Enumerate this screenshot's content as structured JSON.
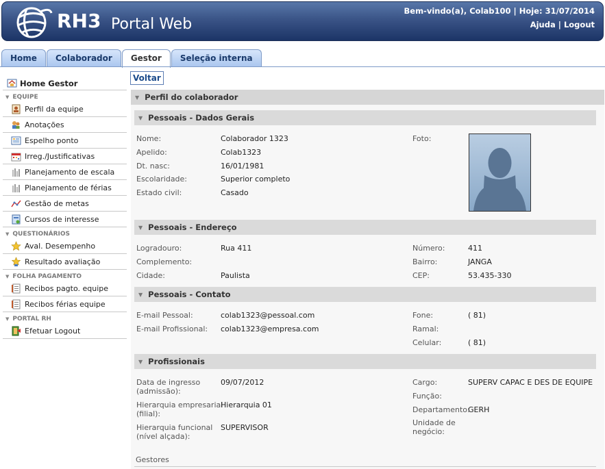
{
  "header": {
    "logo_text": "RH3",
    "logo_sub": "Portal Web",
    "welcome": "Bem-vindo(a), Colab100 | Hoje: 31/07/2014",
    "help": "Ajuda",
    "separator": "|",
    "logout": "Logout"
  },
  "tabs": [
    "Home",
    "Colaborador",
    "Gestor",
    "Seleção interna"
  ],
  "active_tab": "Gestor",
  "sidebar": {
    "home": "Home Gestor",
    "groups": [
      {
        "title": "EQUIPE",
        "items": [
          "Perfil da equipe",
          "Anotações",
          "Espelho ponto",
          "Irreg./Justificativas",
          "Planejamento de escala",
          "Planejamento de férias",
          "Gestão de metas",
          "Cursos de interesse"
        ]
      },
      {
        "title": "QUESTIONÁRIOS",
        "items": [
          "Aval. Desempenho",
          "Resultado avaliação"
        ]
      },
      {
        "title": "FOLHA PAGAMENTO",
        "items": [
          "Recibos pagto. equipe",
          "Recibos férias equipe"
        ]
      },
      {
        "title": "PORTAL RH",
        "items": [
          "Efetuar Logout"
        ]
      }
    ]
  },
  "main": {
    "back_button": "Voltar",
    "profile_title": "Perfil do colaborador",
    "sections": {
      "gerais": {
        "title": "Pessoais - Dados Gerais",
        "fields": [
          {
            "label": "Nome:",
            "value": "Colaborador 1323"
          },
          {
            "label": "Apelido:",
            "value": "Colab1323"
          },
          {
            "label": "Dt. nasc:",
            "value": "16/01/1981"
          },
          {
            "label": "Escolaridade:",
            "value": "Superior completo"
          },
          {
            "label": "Estado civil:",
            "value": "Casado"
          }
        ],
        "photo_label": "Foto:"
      },
      "endereco": {
        "title": "Pessoais - Endereço",
        "left": [
          {
            "label": "Logradouro:",
            "value": "Rua 411"
          },
          {
            "label": "Complemento:",
            "value": ""
          },
          {
            "label": "Cidade:",
            "value": "Paulista"
          }
        ],
        "right": [
          {
            "label": "Número:",
            "value": "411"
          },
          {
            "label": "Bairro:",
            "value": "JANGA"
          },
          {
            "label": "CEP:",
            "value": "53.435-330"
          }
        ]
      },
      "contato": {
        "title": "Pessoais - Contato",
        "left": [
          {
            "label": "E-mail Pessoal:",
            "value": "colab1323@pessoal.com"
          },
          {
            "label": "E-mail Profissional:",
            "value": "colab1323@empresa.com"
          }
        ],
        "right": [
          {
            "label": "Fone:",
            "value": "( 81)"
          },
          {
            "label": "Ramal:",
            "value": ""
          },
          {
            "label": "Celular:",
            "value": "( 81)"
          }
        ]
      },
      "profissionais": {
        "title": "Profissionais",
        "left": [
          {
            "label": [
              "Data de ingresso",
              "(admissão):"
            ],
            "value": "09/07/2012"
          },
          {
            "label": [
              "Hierarquia empresarial",
              "(filial):"
            ],
            "value": "Hierarquia 01"
          },
          {
            "label": [
              "Hierarquia funcional",
              "(nível alçada):"
            ],
            "value": "SUPERVISOR"
          }
        ],
        "right": [
          {
            "label": "Cargo:",
            "value": "SUPERV CAPAC E DES DE EQUIPE"
          },
          {
            "label": "Função:",
            "value": ""
          },
          {
            "label": "Departamento:",
            "value": "GERH"
          },
          {
            "label": [
              "Unidade de",
              "negócio:"
            ],
            "value": ""
          }
        ],
        "gestores_label": "Gestores"
      }
    }
  }
}
